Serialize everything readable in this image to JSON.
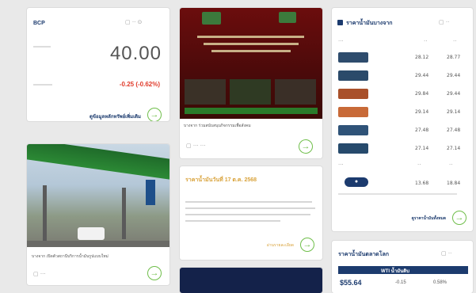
{
  "stock": {
    "symbol": "BCP",
    "price": "40.00",
    "change": "-0.25 (-0.62%)",
    "link_text": "ดูข้อมูลหลักทรัพย์เพิ่มเติม"
  },
  "news_top": {
    "caption": "บางจาก ร่วมสนับสนุนกิจกรรมเพื่อสังคม"
  },
  "gas_station": {
    "caption": "บางจาก เปิดตัวสถานีบริการน้ำมันรูปแบบใหม่"
  },
  "oil_price_news": {
    "title": "ราคาน้ำมันวันที่ 17 ต.ค. 2568",
    "link_text": "อ่านรายละเอียด"
  },
  "oil_table": {
    "title": "ราคาน้ำมันบางจาก",
    "rows": [
      {
        "a": "28.12",
        "b": "28.77",
        "color": "#2e4c6d"
      },
      {
        "a": "29.44",
        "b": "29.44",
        "color": "#2b4a6a"
      },
      {
        "a": "29.84",
        "b": "29.44",
        "color": "#a9502a"
      },
      {
        "a": "29.14",
        "b": "29.14",
        "color": "#c86a38"
      },
      {
        "a": "27.48",
        "b": "27.48",
        "color": "#2f5378"
      },
      {
        "a": "27.14",
        "b": "27.14",
        "color": "#264a6c"
      }
    ],
    "last_row": {
      "a": "13.68",
      "b": "18.84"
    },
    "link_text": "ดูราคาน้ำมันทั้งหมด"
  },
  "wti": {
    "title": "ราคาน้ำมันตลาดโลก",
    "header": "WTI น้ำมันดิบ",
    "price": "$55.64",
    "change": "-0.15",
    "percent": "0.58%"
  }
}
